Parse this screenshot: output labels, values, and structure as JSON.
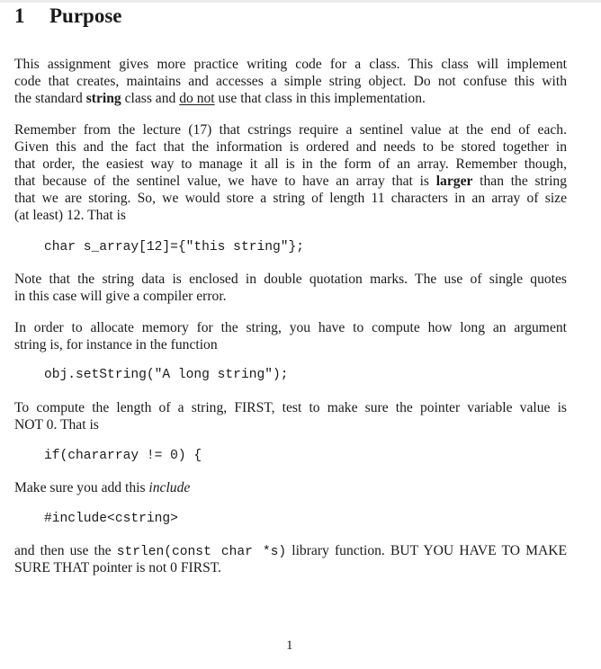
{
  "section": {
    "number": "1",
    "title": "Purpose"
  },
  "paragraphs": {
    "p1": {
      "l1": "This assignment gives more practice writing code for a class.  This class will implement",
      "l2": "code that creates, maintains and accesses a simple string object. Do not confuse this with",
      "l3_pre": "the standard ",
      "l3_bold": "string",
      "l3_mid": " class and ",
      "l3_underline": "do not",
      "l3_post": " use that class in this implementation."
    },
    "p2": {
      "l1": "Remember from the lecture (17) that cstrings require a sentinel value at the end of each.",
      "l2": "Given this and the fact that the information is ordered and needs to be stored together in",
      "l3": "that order, the easiest way to manage it all is in the form of an array. Remember though,",
      "l4_pre": "that because of the sentinel value, we have to have an array that is ",
      "l4_bold": "larger",
      "l4_post": " than the string",
      "l5": "that we are storing. So, we would store a string of length 11 characters in an array of size",
      "l6": "(at least) 12. That is"
    },
    "p3": {
      "l1": "Note that the string data is enclosed in double quotation marks.  The use of single quotes",
      "l2": "in this case will give a compiler error."
    },
    "p4": {
      "l1": "In order to allocate memory for the string, you have to compute how long an argument",
      "l2": "string is, for instance in the function"
    },
    "p5": {
      "l1": "To compute the length of a string, FIRST, test to make sure the pointer variable value is",
      "l2": "NOT 0. That is"
    },
    "p6": {
      "pre": "Make sure you add this ",
      "italic": "include"
    },
    "p7": {
      "l1_pre": "and then use the ",
      "l1_code": "strlen(const char *s)",
      "l1_post": " library function.  BUT YOU HAVE TO MAKE",
      "l2": "SURE THAT pointer is not 0 FIRST."
    }
  },
  "code_blocks": {
    "c1": "char s_array[12]={\"this string\"};",
    "c2": "obj.setString(\"A long string\");",
    "c3": "if(chararray != 0) {",
    "c4": "#include<cstring>"
  },
  "footer": {
    "page_number": "1"
  }
}
